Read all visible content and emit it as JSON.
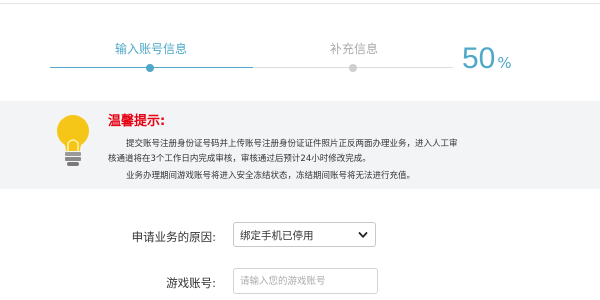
{
  "steps": {
    "step1_label": "输入账号信息",
    "step2_label": "补充信息",
    "progress_value": "50",
    "progress_unit": "%"
  },
  "tip": {
    "title": "温馨提示:",
    "line1": "提交账号注册身份证号码并上传账号注册身份证证件照片正反两面办理业务，进入人工审",
    "line2": "核通道将在3个工作日内完成审核，审核通过后预计24小时修改完成。",
    "line3": "业务办理期间游戏账号将进入安全冻结状态，冻结期间账号将无法进行充值。"
  },
  "form": {
    "reason_label": "申请业务的原因:",
    "reason_value": "绑定手机已停用",
    "account_label": "游戏账号:",
    "account_placeholder": "请输入您的游戏账号"
  },
  "colors": {
    "accent": "#4fa8c8",
    "warning": "#e60012",
    "bulb": "#f5c518"
  }
}
